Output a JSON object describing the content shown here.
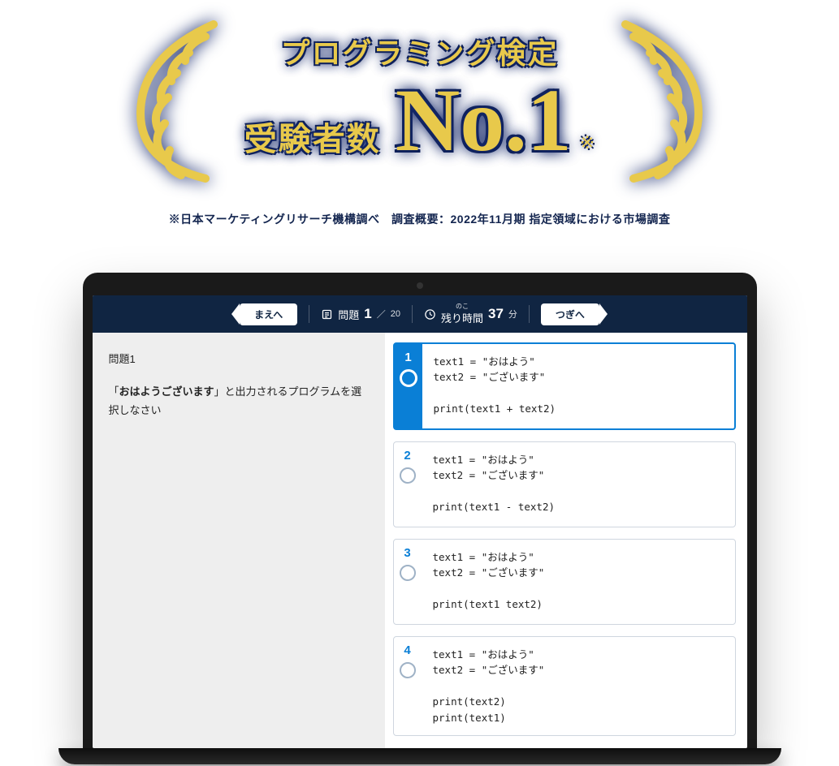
{
  "award": {
    "line1": "プログラミング検定",
    "sub": "受験者数",
    "no1": "No.1",
    "star": "※",
    "caption": "※日本マーケティングリサーチ機構調べ　調査概要：2022年11月期 指定領域における市場調査"
  },
  "topbar": {
    "prev_label": "まえへ",
    "next_label": "つぎへ",
    "question_label": "問題",
    "question_current": "1",
    "question_sep": "／",
    "question_total": "20",
    "time_ruby": "のこ",
    "time_label": "残り時間",
    "time_value": "37",
    "time_unit": "分"
  },
  "question": {
    "title": "問題1",
    "body_prefix": "「",
    "body_bold": "おはようございます",
    "body_suffix": "」と出力されるプログラムを選択しなさい"
  },
  "choices": [
    {
      "n": "1",
      "selected": true,
      "code": "text1 = \"おはよう\"\ntext2 = \"ございます\"\n\nprint(text1 + text2)"
    },
    {
      "n": "2",
      "selected": false,
      "code": "text1 = \"おはよう\"\ntext2 = \"ございます\"\n\nprint(text1 - text2)"
    },
    {
      "n": "3",
      "selected": false,
      "code": "text1 = \"おはよう\"\ntext2 = \"ございます\"\n\nprint(text1 text2)"
    },
    {
      "n": "4",
      "selected": false,
      "code": "text1 = \"おはよう\"\ntext2 = \"ございます\"\n\nprint(text2)\nprint(text1)"
    }
  ]
}
